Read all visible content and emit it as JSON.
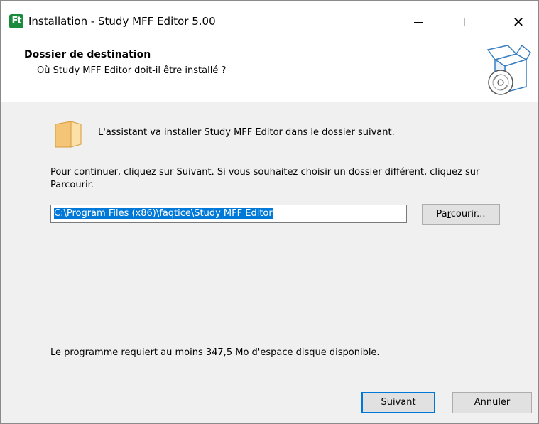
{
  "window": {
    "title": "Installation - Study MFF Editor 5.00",
    "app_icon_text": "Ft",
    "controls": {
      "minimize": "minimize-icon",
      "maximize": "maximize-icon",
      "close": "✕"
    }
  },
  "header": {
    "title": "Dossier de destination",
    "subtitle": "Où Study MFF Editor doit-il être installé ?",
    "graphic": "box-with-disc-icon"
  },
  "body": {
    "intro": "L'assistant va installer Study MFF Editor dans le dossier suivant.",
    "instructions": "Pour continuer, cliquez sur Suivant. Si vous souhaitez choisir un dossier différent, cliquez sur Parcourir.",
    "path_value": "C:\\Program Files (x86)\\faqtice\\Study MFF Editor",
    "browse": {
      "before": "Pa",
      "accel": "r",
      "after": "courir..."
    },
    "space_required": "Le programme requiert au moins 347,5 Mo d'espace disque disponible."
  },
  "footer": {
    "next": {
      "accel": "S",
      "after": "uivant"
    },
    "cancel": "Annuler"
  },
  "colors": {
    "accent": "#0078d7",
    "app_icon": "#1a8a3c",
    "folder": "#f5c577"
  }
}
